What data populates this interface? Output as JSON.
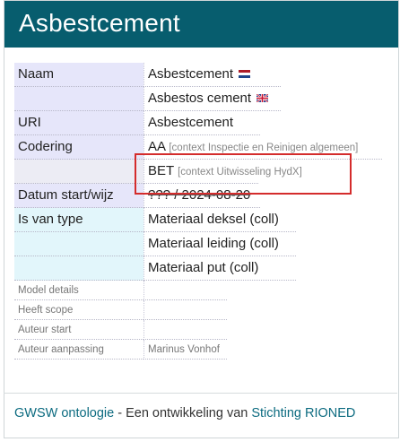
{
  "title": "Asbestcement",
  "rows": {
    "naam": {
      "label": "Naam",
      "value_nl": "Asbestcement",
      "value_en": "Asbestos cement"
    },
    "uri": {
      "label": "URI",
      "value": "Asbestcement"
    },
    "codering": {
      "label": "Codering",
      "code1": "AA",
      "context1": "[context Inspectie en Reinigen algemeen]",
      "code2": "BET",
      "context2": "[context Uitwisseling HydX]"
    },
    "datum": {
      "label": "Datum start/wijz",
      "value": "??? / 2024-08-20"
    },
    "is_van_type": {
      "label": "Is van type",
      "values": [
        "Materiaal deksel (coll)",
        "Materiaal leiding (coll)",
        "Materiaal put (coll)"
      ]
    },
    "model_details": {
      "label": "Model details"
    },
    "heeft_scope": {
      "label": "Heeft scope"
    },
    "auteur_start": {
      "label": "Auteur start"
    },
    "auteur_aanpassing": {
      "label": "Auteur aanpassing",
      "value": "Marinus Vonhof"
    }
  },
  "footer": {
    "link1": "GWSW ontologie",
    "middle": " - Een ontwikkeling van ",
    "link2": "Stichting RIONED"
  },
  "flags": {
    "nl": "dutch-flag-icon",
    "en": "uk-flag-icon"
  },
  "colors": {
    "header": "#075d6e",
    "highlight_box": "#d42c2c",
    "link": "#0c6b80"
  }
}
